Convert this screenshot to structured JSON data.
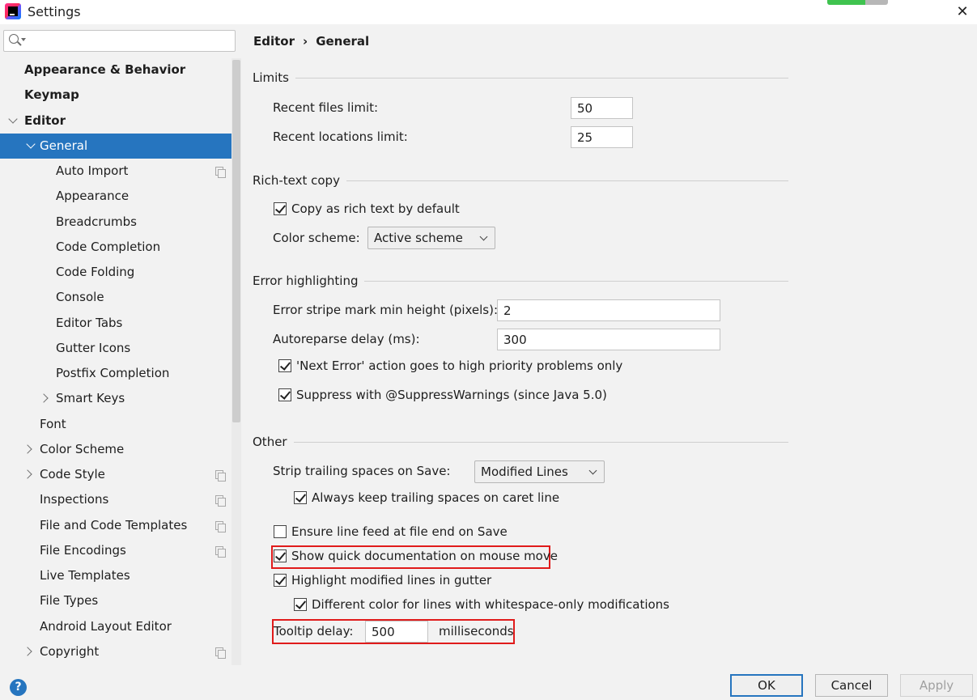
{
  "window": {
    "title": "Settings",
    "close_glyph": "✕",
    "progress_fraction": 0.62
  },
  "search": {
    "value": "",
    "placeholder": ""
  },
  "sidebar": {
    "items": [
      {
        "label": "Appearance & Behavior"
      },
      {
        "label": "Keymap"
      },
      {
        "label": "Editor"
      },
      {
        "label": "General"
      },
      {
        "label": "Auto Import"
      },
      {
        "label": "Appearance"
      },
      {
        "label": "Breadcrumbs"
      },
      {
        "label": "Code Completion"
      },
      {
        "label": "Code Folding"
      },
      {
        "label": "Console"
      },
      {
        "label": "Editor Tabs"
      },
      {
        "label": "Gutter Icons"
      },
      {
        "label": "Postfix Completion"
      },
      {
        "label": "Smart Keys"
      },
      {
        "label": "Font"
      },
      {
        "label": "Color Scheme"
      },
      {
        "label": "Code Style"
      },
      {
        "label": "Inspections"
      },
      {
        "label": "File and Code Templates"
      },
      {
        "label": "File Encodings"
      },
      {
        "label": "Live Templates"
      },
      {
        "label": "File Types"
      },
      {
        "label": "Android Layout Editor"
      },
      {
        "label": "Copyright"
      }
    ]
  },
  "breadcrumb": {
    "parent": "Editor",
    "separator": "›",
    "current": "General"
  },
  "limits": {
    "heading": "Limits",
    "recent_files_label": "Recent files limit:",
    "recent_files_value": "50",
    "recent_locations_label": "Recent locations limit:",
    "recent_locations_value": "25"
  },
  "rich_text": {
    "heading": "Rich-text copy",
    "copy_rich_label": "Copy as rich text by default",
    "color_scheme_label": "Color scheme:",
    "color_scheme_value": "Active scheme"
  },
  "error_highlighting": {
    "heading": "Error highlighting",
    "stripe_label": "Error stripe mark min height (pixels):",
    "stripe_value": "2",
    "autoreparse_label": "Autoreparse delay (ms):",
    "autoreparse_value": "300",
    "next_error_label": "'Next Error' action goes to high priority problems only",
    "suppress_label": "Suppress with @SuppressWarnings (since Java 5.0)"
  },
  "other": {
    "heading": "Other",
    "strip_label": "Strip trailing spaces on Save:",
    "strip_value": "Modified Lines",
    "keep_caret_label": "Always keep trailing spaces on caret line",
    "line_feed_label": "Ensure line feed at file end on Save",
    "quick_doc_label": "Show quick documentation on mouse move",
    "highlight_modified_label": "Highlight modified lines in gutter",
    "whitespace_label": "Different color for lines with whitespace-only modifications",
    "tooltip_label": "Tooltip delay:",
    "tooltip_value": "500",
    "tooltip_unit": "milliseconds"
  },
  "buttons": {
    "help": "?",
    "ok": "OK",
    "cancel": "Cancel",
    "apply": "Apply"
  },
  "colors": {
    "selection": "#2675bf",
    "highlight_box": "#e01b1b",
    "background": "#f2f2f2"
  }
}
